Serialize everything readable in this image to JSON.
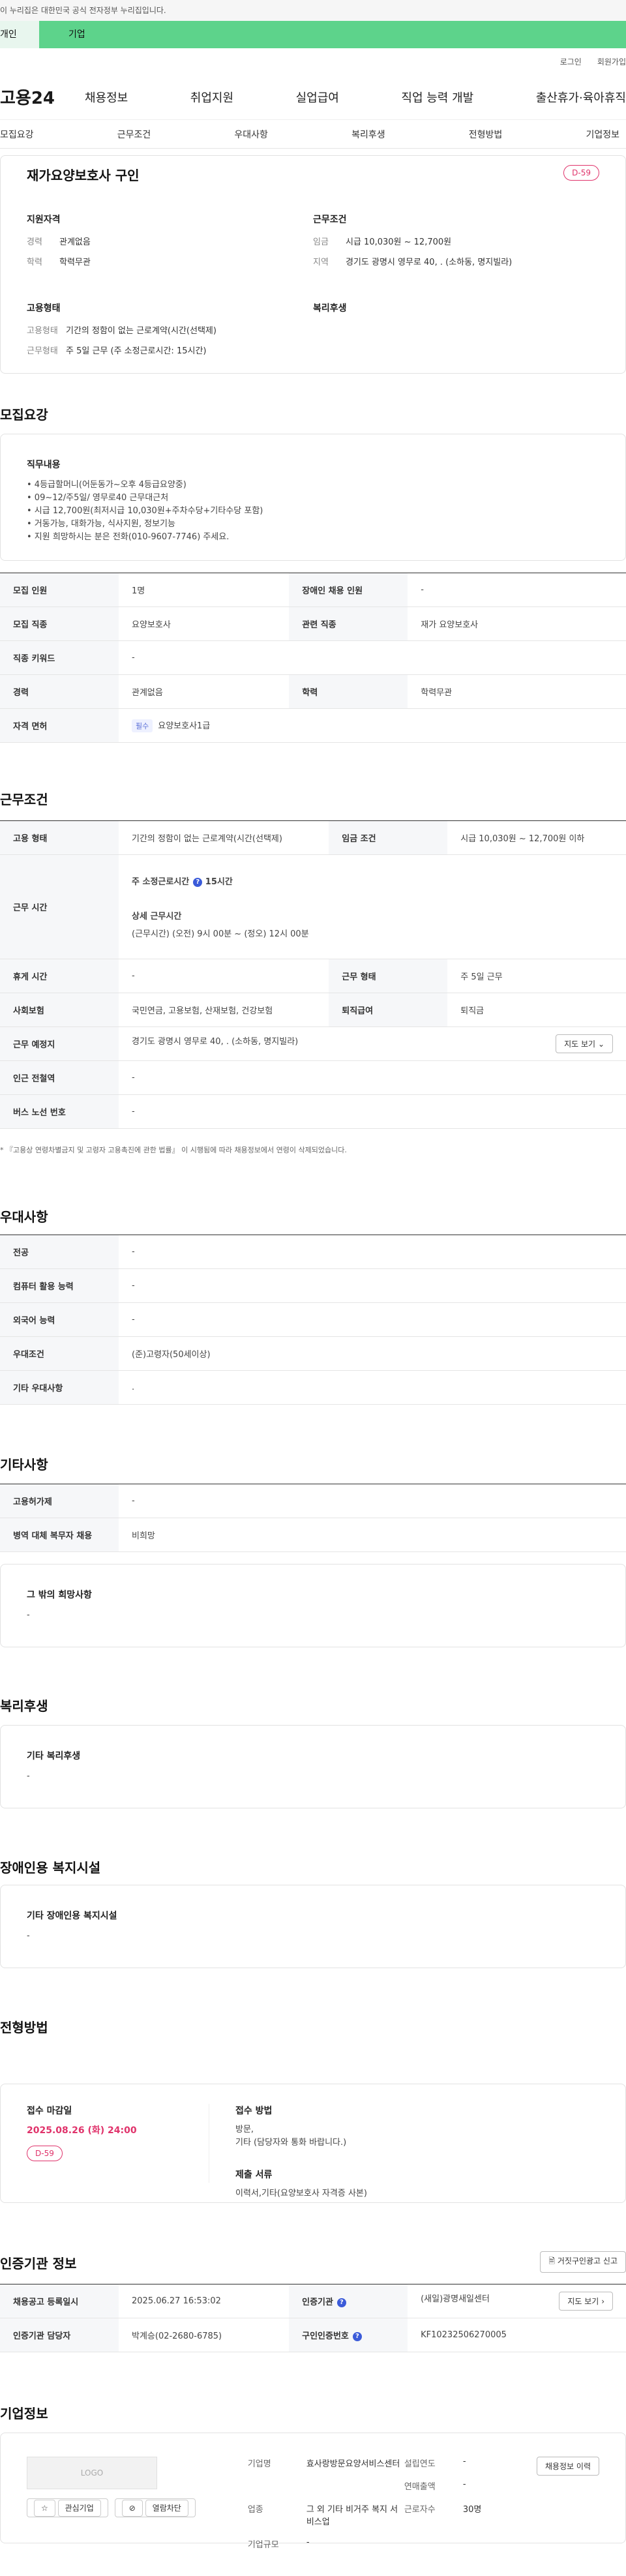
{
  "notice": "이 누리집은 대한민국 공식 전자정부 누리집입니다.",
  "topbar": {
    "personal": "개인",
    "company": "기업"
  },
  "util": {
    "login": "로그인",
    "signup": "회원가입"
  },
  "gnb": {
    "logo": "고용24",
    "items": [
      "채용정보",
      "취업지원",
      "실업급여",
      "직업 능력 개발",
      "출산휴가·육아휴직"
    ]
  },
  "subnav": [
    "모집요강",
    "근무조건",
    "우대사항",
    "복리후생",
    "전형방법",
    "기업정보"
  ],
  "summary": {
    "title": "재가요양보호사 구인",
    "dday": "D-59",
    "qual_title": "지원자격",
    "career_k": "경력",
    "career_v": "관계없음",
    "edu_k": "학력",
    "edu_v": "학력무관",
    "cond_title": "근무조건",
    "wage_k": "임금",
    "wage_v": "시급 10,030원 ~ 12,700원",
    "area_k": "지역",
    "area_v": "경기도 광명시 영무로 40, . (소하동, 명지빌라)",
    "type_title": "고용형태",
    "etype_k": "고용형태",
    "etype_v": "기간의 정함이 없는 근로계약(시간(선택제)",
    "wtype_k": "근무형태",
    "wtype_v": "주 5일 근무 (주 소정근로시간: 15시간)",
    "welfare_title": "복리후생"
  },
  "recruit": {
    "title": "모집요강",
    "duty_title": "직무내용",
    "duty_lines": [
      "• 4등급할머니(어둔동가~오후 4등급요양중)",
      "• 09~12/주5일/ 영무로40 근무대근처",
      "• 시급 12,700원(최저시급 10,030원+주차수당+기타수당 포함)",
      "• 거동가능, 대화가능, 식사지원, 정보기능",
      "• 지원 희망하시는 분은 전화(010-9607-7746) 주세요."
    ],
    "rows": [
      [
        "모집 인원",
        "1명",
        "장애인 채용 인원",
        "-"
      ],
      [
        "모집 직종",
        "요양보호사",
        "관련 직종",
        "재가 요양보호사"
      ],
      [
        "직종 키워드",
        "-"
      ],
      [
        "경력",
        "관계없음",
        "학력",
        "학력무관"
      ],
      [
        "자격 면허",
        "요양보호사1급"
      ]
    ],
    "cert_badge": "필수"
  },
  "work": {
    "title": "근무조건",
    "etype_k": "고용 형태",
    "etype_v": "기간의 정함이 없는 근로계약(시간(선택제)",
    "wage_k": "임금 조건",
    "wage_v": "시급 10,030원 ~ 12,700원 이하",
    "hours_k": "근무 시간",
    "hours_week": "주 소정근로시간",
    "hours_week_v": "15시간",
    "hours_detail_title": "상세 근무시간",
    "hours_detail_v": "(근무시간) (오전) 9시 00분 ~ (정오) 12시 00분",
    "break_k": "휴게 시간",
    "break_v": "-",
    "wform_k": "근무 형태",
    "wform_v": "주 5일 근무",
    "ins_k": "사회보험",
    "ins_v": "국민연금, 고용보험, 산재보험, 건강보험",
    "sev_k": "퇴직급여",
    "sev_v": "퇴직금",
    "place_k": "근무 예정지",
    "place_v": "경기도 광명시 영무로 40, . (소하동, 명지빌라)",
    "map_btn": "지도 보기",
    "subway_k": "인근 전철역",
    "subway_v": "-",
    "bus_k": "버스 노선 번호",
    "bus_v": "-",
    "footnote": "* 『고용상 연령차별금지 및 고령자 고용촉진에 관한 법률』 이 시행됨에 따라 채용정보에서 연령이 삭제되었습니다."
  },
  "pref": {
    "title": "우대사항",
    "rows": [
      [
        "전공",
        "-"
      ],
      [
        "컴퓨터 활용 능력",
        "-"
      ],
      [
        "외국어 능력",
        "-"
      ],
      [
        "우대조건",
        "(준)고령자(50세이상)"
      ],
      [
        "기타 우대사항",
        "."
      ]
    ]
  },
  "etc": {
    "title": "기타사항",
    "rows": [
      [
        "고용허가제",
        "-"
      ],
      [
        "병역 대체 복무자 채용",
        "비희망"
      ]
    ],
    "other_title": "그 밖의 희망사항",
    "other_v": "-"
  },
  "welfare": {
    "title": "복리후생",
    "box_title": "기타 복리후생",
    "box_v": "-"
  },
  "disabled": {
    "title": "장애인용 복지시설",
    "box_title": "기타 장애인용 복지시설",
    "box_v": "-"
  },
  "process": {
    "title": "전형방법",
    "deadline_title": "접수 마감일",
    "deadline_v": "2025.08.26 (화) 24:00",
    "dday": "D-59",
    "method_title": "접수 방법",
    "method_v1": "방문,",
    "method_v2": "기타 (담당자와 통화 바랍니다.)",
    "docs_title": "제출 서류",
    "docs_v": "이력서,기타(요양보호사 자격증 사본)"
  },
  "auth": {
    "title": "인증기관 정보",
    "report_btn": "거짓구인광고 신고",
    "reg_k": "채용공고 등록일시",
    "reg_v": "2025.06.27 16:53:02",
    "org_k": "인증기관",
    "org_v": "(새일)광명새일센터",
    "map_btn": "지도 보기",
    "mgr_k": "인증기관 담당자",
    "mgr_v": "박계승(02-2680-6785)",
    "no_k": "구인인증번호",
    "no_v": "KF10232506270005"
  },
  "company": {
    "title": "기업정보",
    "logo": "LOGO",
    "fav_btn": "관심기업",
    "block_btn": "열람차단",
    "history_btn": "채용정보 이력",
    "name_k": "기업명",
    "name_v": "효사랑방문요양서비스센터",
    "year_k": "설립연도",
    "year_v": "-",
    "sales_k": "연매출액",
    "sales_v": "-",
    "ind_k": "업종",
    "ind_v": "그 외 기타 비거주 복지 서비스업",
    "emp_k": "근로자수",
    "emp_v": "30명",
    "size_k": "기업규모",
    "size_v": "-"
  }
}
